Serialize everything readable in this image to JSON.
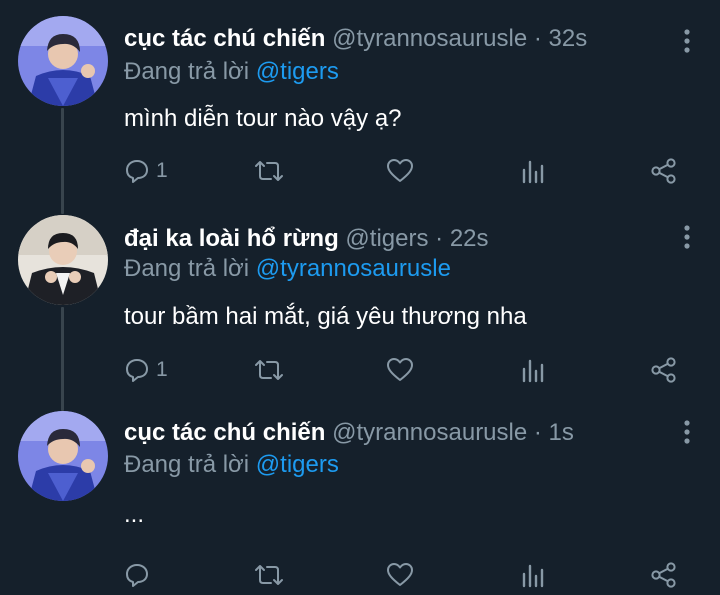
{
  "tweets": [
    {
      "name": "cục tác chú chiến",
      "handle": "@tyrannosaurusle",
      "time": "· 32s",
      "reply_prefix": "Đang trả lời",
      "reply_to": "@tigers",
      "text": "mình diễn tour nào vậy ạ?",
      "reply_count": "1",
      "avatar": "avatar-blue-portrait"
    },
    {
      "name": "đại ka loài hổ rừng",
      "handle": "@tigers",
      "time": "· 22s",
      "reply_prefix": "Đang trả lời",
      "reply_to": "@tyrannosaurusle",
      "text": "tour bầm hai mắt, giá yêu thương nha",
      "reply_count": "1",
      "avatar": "avatar-suit-portrait"
    },
    {
      "name": "cục tác chú chiến",
      "handle": "@tyrannosaurusle",
      "time": "· 1s",
      "reply_prefix": "Đang trả lời",
      "reply_to": "@tigers",
      "text": "...",
      "reply_count": "",
      "avatar": "avatar-blue-portrait"
    }
  ],
  "icons": {
    "reply": "reply-icon",
    "retweet": "retweet-icon",
    "like": "heart-icon",
    "analytics": "analytics-icon",
    "share": "share-icon",
    "more": "more-vertical-icon"
  },
  "colors": {
    "background": "#15202b",
    "muted": "#8899a6",
    "mention": "#1d9bf0",
    "thread_line": "#38444d"
  }
}
